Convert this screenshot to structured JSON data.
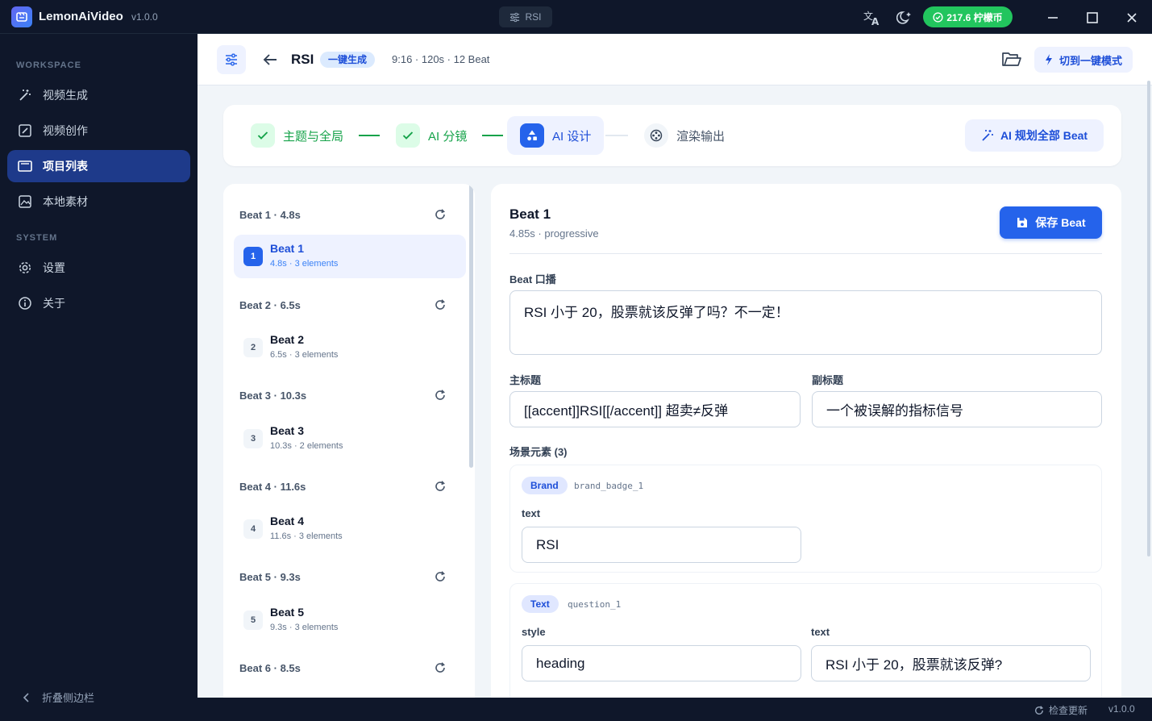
{
  "app": {
    "name": "LemonAiVideo",
    "version": "v1.0.0",
    "center_tab": "RSI",
    "coins": "217.6 柠檬币"
  },
  "sidebar": {
    "workspace_label": "WORKSPACE",
    "system_label": "SYSTEM",
    "items": [
      {
        "label": "视频生成",
        "icon": "magic-wand-icon"
      },
      {
        "label": "视频创作",
        "icon": "edit-icon"
      },
      {
        "label": "项目列表",
        "icon": "folder-icon",
        "active": true
      },
      {
        "label": "本地素材",
        "icon": "image-icon"
      }
    ],
    "system_items": [
      {
        "label": "设置",
        "icon": "gear-icon"
      },
      {
        "label": "关于",
        "icon": "info-icon"
      }
    ],
    "collapse_label": "折叠侧边栏"
  },
  "topbar": {
    "title": "RSI",
    "mode_badge": "一键生成",
    "meta": "9:16 · 120s · 12 Beat",
    "switch_label": "切到一键模式"
  },
  "steps": [
    {
      "label": "主题与全局",
      "state": "done"
    },
    {
      "label": "AI 分镜",
      "state": "done"
    },
    {
      "label": "AI 设计",
      "state": "current"
    },
    {
      "label": "渲染输出",
      "state": "todo"
    }
  ],
  "plan_all_label": "AI 规划全部 Beat",
  "beats": [
    {
      "header": "Beat 1 · 4.8s",
      "num": "1",
      "name": "Beat 1",
      "sub": "4.8s · 3 elements",
      "active": true
    },
    {
      "header": "Beat 2 · 6.5s",
      "num": "2",
      "name": "Beat 2",
      "sub": "6.5s · 3 elements"
    },
    {
      "header": "Beat 3 · 10.3s",
      "num": "3",
      "name": "Beat 3",
      "sub": "10.3s · 2 elements"
    },
    {
      "header": "Beat 4 · 11.6s",
      "num": "4",
      "name": "Beat 4",
      "sub": "11.6s · 3 elements"
    },
    {
      "header": "Beat 5 · 9.3s",
      "num": "5",
      "name": "Beat 5",
      "sub": "9.3s · 3 elements"
    },
    {
      "header": "Beat 6 · 8.5s"
    }
  ],
  "editor": {
    "title": "Beat 1",
    "subtitle": "4.85s · progressive",
    "save_label": "保存 Beat",
    "narration_label": "Beat 口播",
    "narration_value": "RSI 小于 20，股票就该反弹了吗？不一定！",
    "main_title_label": "主标题",
    "main_title_value": "[[accent]]RSI[[/accent]] 超卖≠反弹",
    "sub_title_label": "副标题",
    "sub_title_value": "一个被误解的指标信号",
    "elements_label": "场景元素 (3)",
    "elements": [
      {
        "type": "Brand",
        "id": "brand_badge_1",
        "field_label": "text",
        "field_value": "RSI"
      },
      {
        "type": "Text",
        "id": "question_1",
        "style_label": "style",
        "style_value": "heading",
        "text_label": "text",
        "text_value": "RSI 小于 20，股票就该反弹?"
      }
    ]
  },
  "footer": {
    "update_label": "检查更新",
    "version": "v1.0.0"
  }
}
